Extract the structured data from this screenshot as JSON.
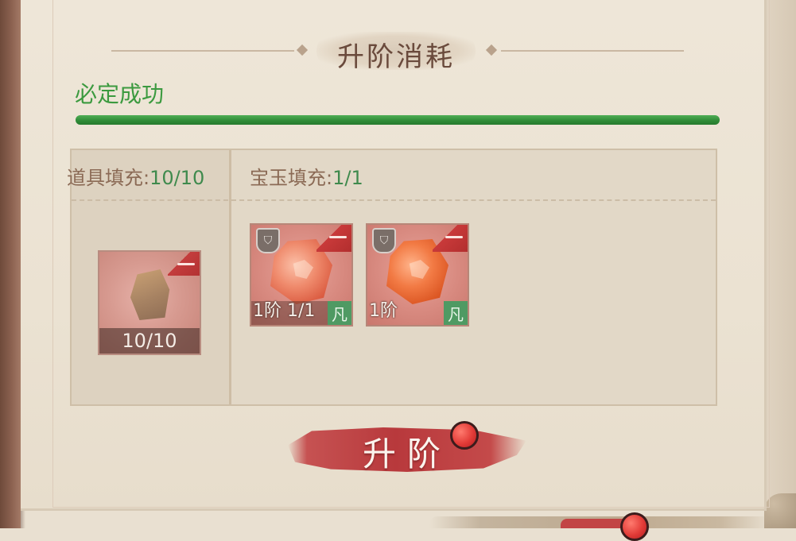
{
  "header": {
    "title": "升阶消耗"
  },
  "success": {
    "text": "必定成功",
    "progress": 1.0
  },
  "fill": {
    "item_label": "道具填充:",
    "item_value": "10/10",
    "gem_label": "宝玉填充:",
    "gem_value": "1/1"
  },
  "item_slot": {
    "count": "10/10",
    "icon": "ore-icon"
  },
  "gems": [
    {
      "tier_label": "1阶 1/1",
      "rarity": "凡",
      "icon": "gem-icon",
      "badge_icon": "shield-icon"
    },
    {
      "tier_label": "1阶",
      "rarity": "凡",
      "icon": "gem-icon",
      "badge_icon": "shield-icon"
    }
  ],
  "action": {
    "upgrade_label": "升阶"
  },
  "colors": {
    "success": "#3b9a3f",
    "accent_red": "#b8393c",
    "rarity_green": "#4f9a63"
  }
}
